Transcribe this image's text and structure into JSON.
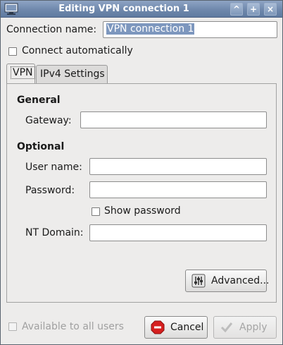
{
  "window": {
    "title": "Editing VPN connection 1",
    "controls": [
      "^",
      "+",
      "×"
    ]
  },
  "connection": {
    "name_label": "Connection name:",
    "name_value": "VPN connection 1",
    "connect_auto_label": "Connect automatically",
    "connect_auto_checked": false
  },
  "tabs": [
    {
      "label": "VPN",
      "active": true
    },
    {
      "label": "IPv4 Settings",
      "active": false
    }
  ],
  "general": {
    "heading": "General",
    "gateway_label": "Gateway:",
    "gateway_value": ""
  },
  "optional": {
    "heading": "Optional",
    "username_label": "User name:",
    "username_value": "",
    "password_label": "Password:",
    "password_value": "",
    "show_password_label": "Show password",
    "show_password_checked": false,
    "ntdomain_label": "NT Domain:",
    "ntdomain_value": ""
  },
  "buttons": {
    "advanced": "Advanced...",
    "cancel": "Cancel",
    "apply": "Apply"
  },
  "footer": {
    "available_all_users_label": "Available to all users",
    "available_all_users_checked": false
  },
  "colors": {
    "titlebar": "#6f88ac",
    "selection": "#7d97be",
    "cancel_icon": "#d61f1f"
  }
}
